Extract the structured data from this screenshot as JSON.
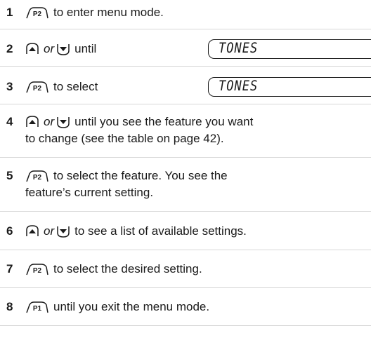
{
  "steps": [
    {
      "num": "1",
      "key": "P2",
      "text": "to enter menu mode."
    },
    {
      "num": "2",
      "or": "or",
      "text": "until",
      "display": "TONES"
    },
    {
      "num": "3",
      "key": "P2",
      "text": "to select",
      "display": "TONES"
    },
    {
      "num": "4",
      "or": "or",
      "line1": "until you see the feature you want",
      "line2": "to change (see the table on page 42)."
    },
    {
      "num": "5",
      "key": "P2",
      "line1": "to select the feature. You see the",
      "line2": "feature’s current setting."
    },
    {
      "num": "6",
      "or": "or",
      "text": "to see a list of available settings."
    },
    {
      "num": "7",
      "key": "P2",
      "text": "to select the desired setting."
    },
    {
      "num": "8",
      "key": "P1",
      "text": "until you exit the menu mode."
    }
  ],
  "icons": {
    "key": "programmable-button-icon",
    "up": "up-arrow-button-icon",
    "down": "down-arrow-button-icon"
  }
}
